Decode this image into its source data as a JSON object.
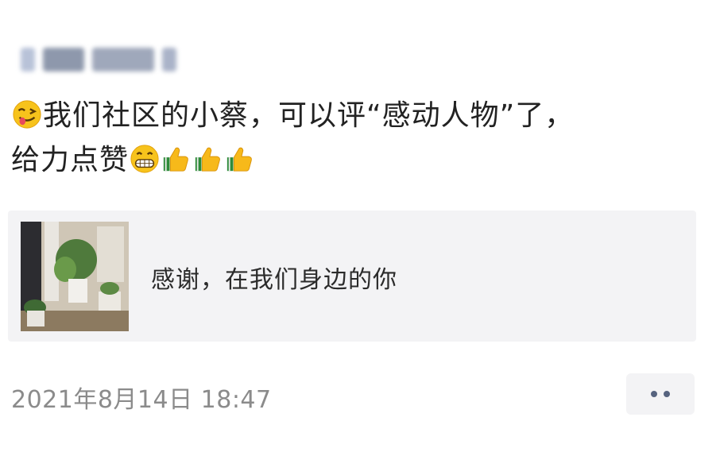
{
  "post": {
    "text_line1": "我们社区的小蔡，可以评“感动人物”了，",
    "text_line2": "给力点赞",
    "emojis": [
      "winking-tongue-emoji",
      "grinning-emoji",
      "thumbs-up-emoji",
      "thumbs-up-emoji",
      "thumbs-up-emoji"
    ],
    "link_card": {
      "title": "感谢，在我们身边的你"
    },
    "timestamp": "2021年8月14日 18:47"
  },
  "colors": {
    "card_background": "#f3f3f5",
    "timestamp": "#8b8b8b",
    "more_dots": "#56637f"
  }
}
